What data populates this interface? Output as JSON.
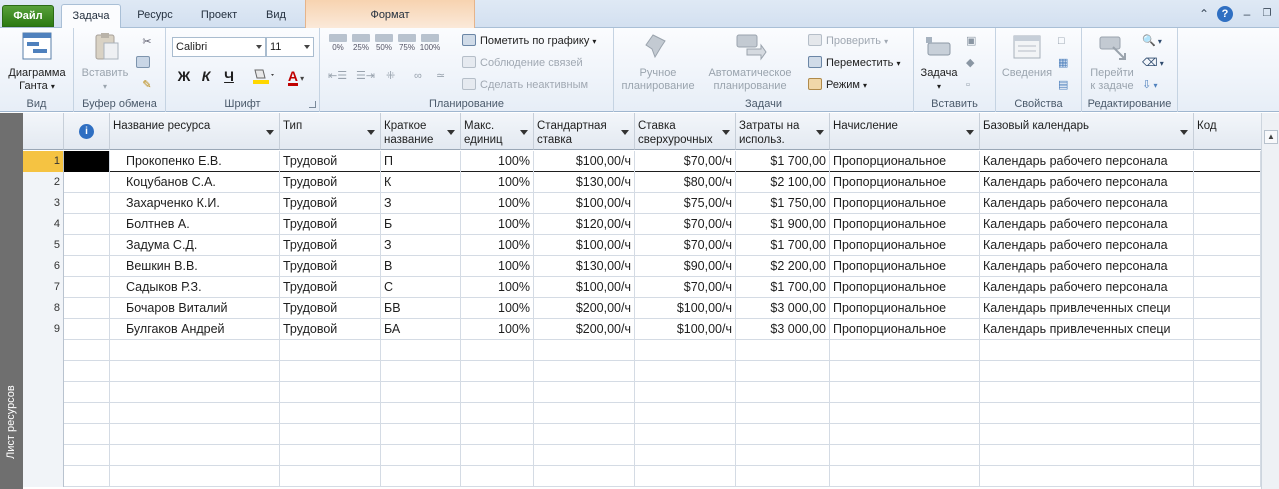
{
  "tabs": {
    "file": "Файл",
    "task": "Задача",
    "resource": "Ресурс",
    "project": "Проект",
    "view": "Вид",
    "format": "Формат"
  },
  "ribbon": {
    "view_group": {
      "gantt_line1": "Диаграмма",
      "gantt_line2": "Ганта",
      "label": "Вид"
    },
    "clipboard_group": {
      "paste": "Вставить",
      "label": "Буфер обмена"
    },
    "font_group": {
      "font_name": "Calibri",
      "font_size": "11",
      "bold": "Ж",
      "italic": "К",
      "underline": "Ч",
      "font_color_glyph": "А",
      "label": "Шрифт"
    },
    "schedule_group": {
      "pct": [
        "0%",
        "25%",
        "50%",
        "75%",
        "100%"
      ],
      "mark_on_track": "Пометить по графику",
      "respect_links": "Соблюдение связей",
      "inactivate": "Сделать неактивным",
      "label": "Планирование"
    },
    "tasks_group": {
      "manual_line1": "Ручное",
      "manual_line2": "планирование",
      "auto_line1": "Автоматическое",
      "auto_line2": "планирование",
      "inspect": "Проверить",
      "move": "Переместить",
      "mode": "Режим",
      "label": "Задачи"
    },
    "insert_group": {
      "task": "Задача",
      "label": "Вставить"
    },
    "properties_group": {
      "info": "Сведения",
      "label": "Свойства"
    },
    "editing_group": {
      "goto_line1": "Перейти",
      "goto_line2": "к задаче",
      "label": "Редактирование"
    }
  },
  "sidebar_label": "Лист ресурсов",
  "columns": {
    "name": "Название ресурса",
    "type": "Тип",
    "initials_line1": "Краткое",
    "initials_line2": "название",
    "max_line1": "Макс.",
    "max_line2": "единиц",
    "std_line1": "Стандартная",
    "std_line2": "ставка",
    "ovt_line1": "Ставка",
    "ovt_line2": "сверхурочных",
    "cost_line1": "Затраты на",
    "cost_line2": "использ.",
    "accrue": "Начисление",
    "calendar": "Базовый календарь",
    "code": "Код"
  },
  "rows": [
    {
      "id": "1",
      "name": "Прокопенко Е.В.",
      "type": "Трудовой",
      "initials": "П",
      "max": "100%",
      "std": "$100,00/ч",
      "ovt": "$70,00/ч",
      "cost": "$1 700,00",
      "accrue": "Пропорциональное",
      "calendar": "Календарь рабочего персонала"
    },
    {
      "id": "2",
      "name": "Коцубанов С.А.",
      "type": "Трудовой",
      "initials": "К",
      "max": "100%",
      "std": "$130,00/ч",
      "ovt": "$80,00/ч",
      "cost": "$2 100,00",
      "accrue": "Пропорциональное",
      "calendar": "Календарь рабочего персонала"
    },
    {
      "id": "3",
      "name": "Захарченко К.И.",
      "type": "Трудовой",
      "initials": "З",
      "max": "100%",
      "std": "$100,00/ч",
      "ovt": "$75,00/ч",
      "cost": "$1 750,00",
      "accrue": "Пропорциональное",
      "calendar": "Календарь рабочего персонала"
    },
    {
      "id": "4",
      "name": "Болтнев А.",
      "type": "Трудовой",
      "initials": "Б",
      "max": "100%",
      "std": "$120,00/ч",
      "ovt": "$70,00/ч",
      "cost": "$1 900,00",
      "accrue": "Пропорциональное",
      "calendar": "Календарь рабочего персонала"
    },
    {
      "id": "5",
      "name": "Задума С.Д.",
      "type": "Трудовой",
      "initials": "З",
      "max": "100%",
      "std": "$100,00/ч",
      "ovt": "$70,00/ч",
      "cost": "$1 700,00",
      "accrue": "Пропорциональное",
      "calendar": "Календарь рабочего персонала"
    },
    {
      "id": "6",
      "name": "Вешкин В.В.",
      "type": "Трудовой",
      "initials": "В",
      "max": "100%",
      "std": "$130,00/ч",
      "ovt": "$90,00/ч",
      "cost": "$2 200,00",
      "accrue": "Пропорциональное",
      "calendar": "Календарь рабочего персонала"
    },
    {
      "id": "7",
      "name": "Садыков Р.З.",
      "type": "Трудовой",
      "initials": "С",
      "max": "100%",
      "std": "$100,00/ч",
      "ovt": "$70,00/ч",
      "cost": "$1 700,00",
      "accrue": "Пропорциональное",
      "calendar": "Календарь рабочего персонала"
    },
    {
      "id": "8",
      "name": "Бочаров Виталий",
      "type": "Трудовой",
      "initials": "БВ",
      "max": "100%",
      "std": "$200,00/ч",
      "ovt": "$100,00/ч",
      "cost": "$3 000,00",
      "accrue": "Пропорциональное",
      "calendar": "Календарь привлеченных специ"
    },
    {
      "id": "9",
      "name": "Булгаков Андрей",
      "type": "Трудовой",
      "initials": "БА",
      "max": "100%",
      "std": "$200,00/ч",
      "ovt": "$100,00/ч",
      "cost": "$3 000,00",
      "accrue": "Пропорциональное",
      "calendar": "Календарь привлеченных специ"
    }
  ],
  "colors": {
    "file_tab": "#2c7a12",
    "sidebar": "#6f6f6f",
    "selected_row": "#f5c342",
    "context_tab": "#f7d3b0"
  }
}
